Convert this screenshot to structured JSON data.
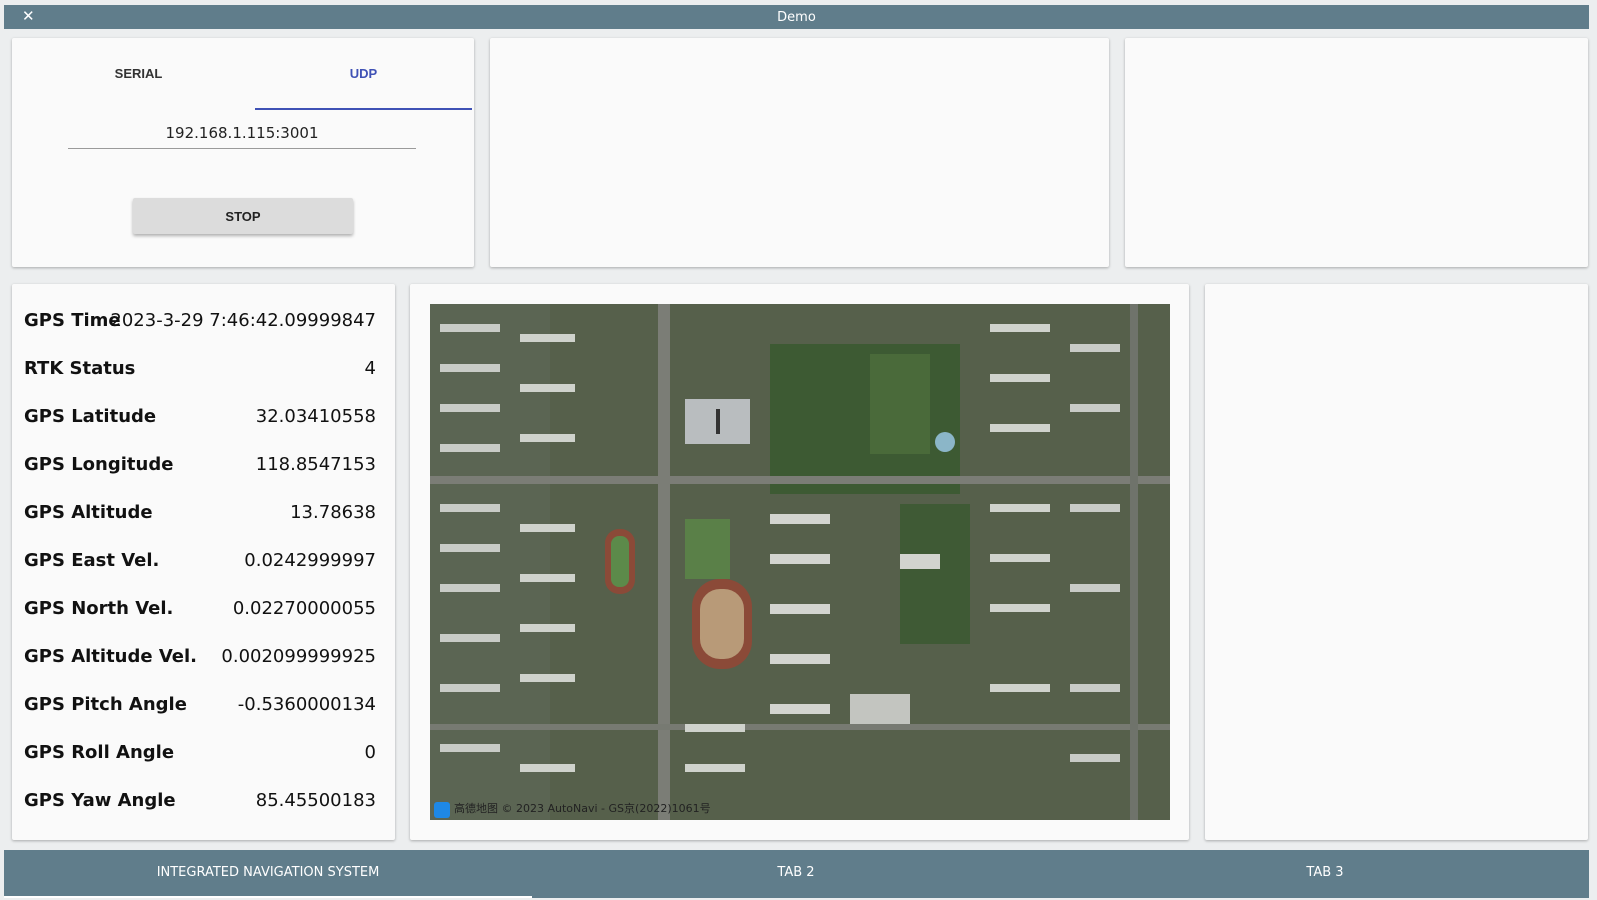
{
  "window": {
    "title": "Demo",
    "close_glyph": "✕"
  },
  "connection": {
    "tabs": [
      {
        "label": "SERIAL"
      },
      {
        "label": "UDP"
      }
    ],
    "active_tab": "UDP",
    "address_value": "192.168.1.115:3001",
    "button_label": "STOP"
  },
  "gps": {
    "rows": [
      {
        "label": "GPS Time",
        "value": "2023-3-29 7:46:42.09999847"
      },
      {
        "label": "RTK Status",
        "value": "4"
      },
      {
        "label": "GPS Latitude",
        "value": "32.03410558"
      },
      {
        "label": "GPS Longitude",
        "value": "118.8547153"
      },
      {
        "label": "GPS Altitude",
        "value": "13.78638"
      },
      {
        "label": "GPS East Vel.",
        "value": "0.0242999997"
      },
      {
        "label": "GPS North Vel.",
        "value": "0.02270000055"
      },
      {
        "label": "GPS Altitude Vel.",
        "value": "0.002099999925"
      },
      {
        "label": "GPS Pitch Angle",
        "value": "-0.5360000134"
      },
      {
        "label": "GPS Roll Angle",
        "value": "0"
      },
      {
        "label": "GPS Yaw Angle",
        "value": "85.45500183"
      }
    ]
  },
  "map": {
    "attribution": "高德地图 © 2023 AutoNavi - GS京(2022)1061号"
  },
  "bottom_tabs": [
    {
      "label": "INTEGRATED NAVIGATION SYSTEM"
    },
    {
      "label": "TAB 2"
    },
    {
      "label": "TAB 3"
    }
  ],
  "colors": {
    "bar": "#607d8b",
    "accent": "#3f51b5",
    "card": "#fafafa"
  }
}
